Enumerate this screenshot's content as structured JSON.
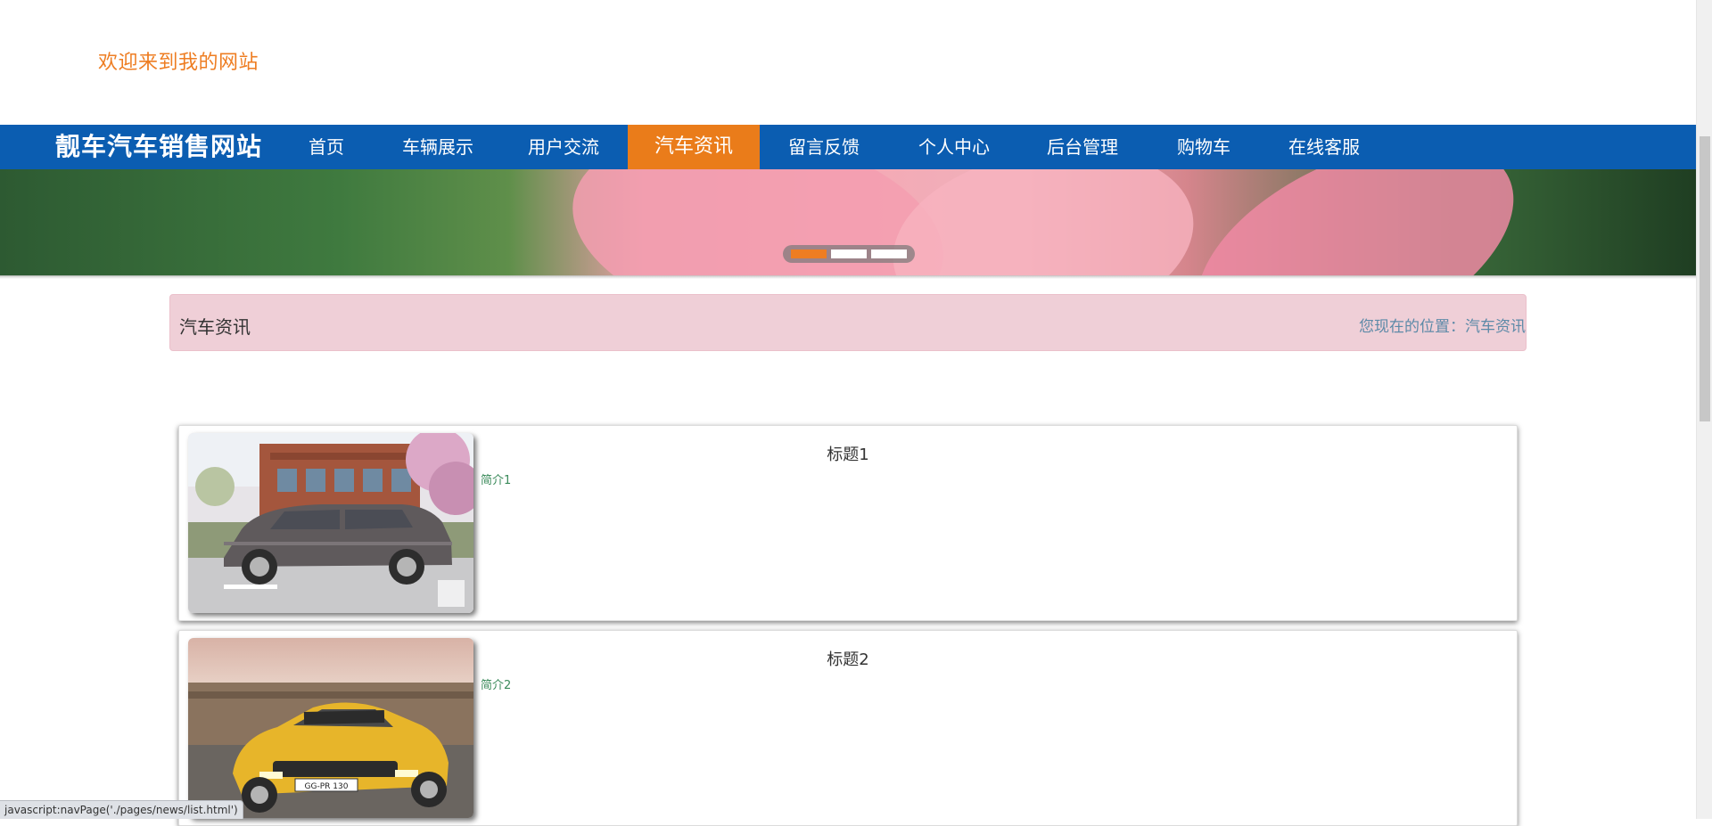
{
  "header": {
    "welcome": "欢迎来到我的网站"
  },
  "nav": {
    "brand": "靓车汽车销售网站",
    "items": [
      {
        "label": "首页",
        "active": false
      },
      {
        "label": "车辆展示",
        "active": false
      },
      {
        "label": "用户交流",
        "active": false
      },
      {
        "label": "汽车资讯",
        "active": true
      },
      {
        "label": "留言反馈",
        "active": false
      },
      {
        "label": "个人中心",
        "active": false
      },
      {
        "label": "后台管理",
        "active": false
      },
      {
        "label": "购物车",
        "active": false
      },
      {
        "label": "在线客服",
        "active": false
      }
    ],
    "bg_color": "#0b5db1",
    "active_color": "#ea7c1a"
  },
  "banner": {
    "slide_count": 3,
    "active_slide": 0
  },
  "breadcrumb": {
    "title": "汽车资讯",
    "location_label": "您现在的位置：",
    "location_value": "汽车资讯"
  },
  "news": [
    {
      "title": "标题1",
      "intro": "简介1",
      "image": "gray-minivan-photo"
    },
    {
      "title": "标题2",
      "intro": "简介2",
      "image": "yellow-sports-car-photo"
    }
  ],
  "status_bar": {
    "url": "javascript:navPage('./pages/news/list.html')"
  }
}
